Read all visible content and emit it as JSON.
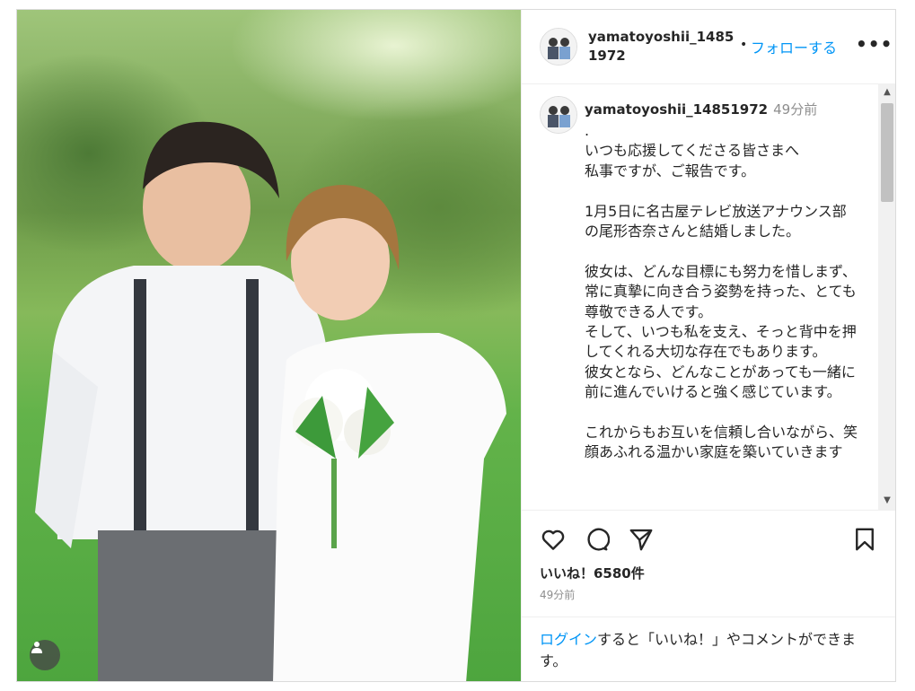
{
  "header": {
    "username": "yamatoyoshii_14851972",
    "dot": "•",
    "follow_label": "フォローする",
    "more_icon": "more-icon"
  },
  "comment": {
    "username": "yamatoyoshii_14851972",
    "time": "49分前",
    "lines": [
      ".",
      "いつも応援してくださる皆さまへ",
      "私事ですが、ご報告です。",
      "",
      "1月5日に名古屋テレビ放送アナウンス部の尾形杏奈さんと結婚しました。",
      "",
      "彼女は、どんな目標にも努力を惜しまず、常に真摯に向き合う姿勢を持った、とても尊敬できる人です。",
      "そして、いつも私を支え、そっと背中を押してくれる大切な存在でもあります。",
      "彼女となら、どんなことがあっても一緒に前に進んでいけると強く感じています。",
      "",
      "これからもお互いを信頼し合いながら、笑顔あふれる温かい家庭を築いていきます"
    ]
  },
  "actions": {
    "like_icon": "heart-icon",
    "comment_icon": "comment-icon",
    "share_icon": "share-icon",
    "save_icon": "bookmark-icon"
  },
  "likes_text": "いいね！6580件",
  "posted_ago": "49分前",
  "login_prompt": {
    "link": "ログイン",
    "rest": "すると「いいね！」やコメントができます。"
  },
  "colors": {
    "link_blue": "#0095f6",
    "text_dark": "#262626",
    "text_muted": "#8e8e8e"
  }
}
